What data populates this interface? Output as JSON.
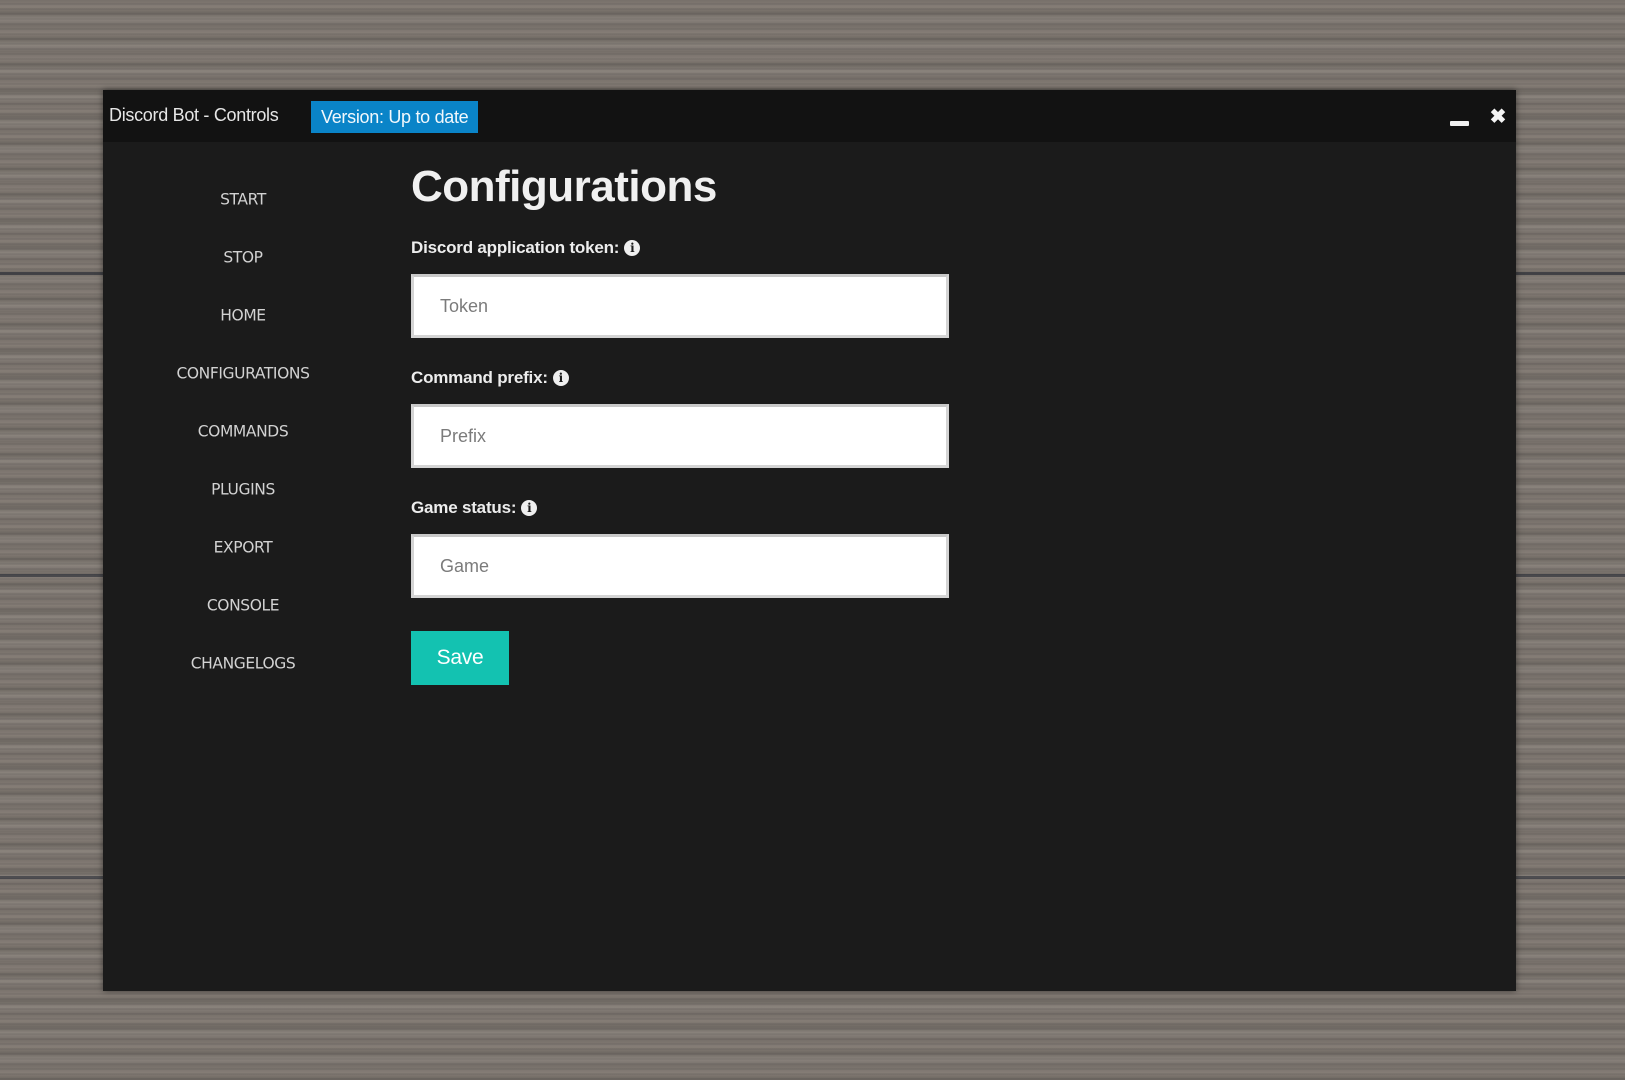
{
  "window": {
    "title": "Discord Bot - Controls",
    "version_badge": "Version: Up to date",
    "minimize_icon": "minimize-icon",
    "close_icon": "close-icon",
    "close_glyph": "✖"
  },
  "sidebar": {
    "items": [
      {
        "label": "START"
      },
      {
        "label": "STOP"
      },
      {
        "label": "HOME"
      },
      {
        "label": "CONFIGURATIONS"
      },
      {
        "label": "COMMANDS"
      },
      {
        "label": "PLUGINS"
      },
      {
        "label": "EXPORT"
      },
      {
        "label": "CONSOLE"
      },
      {
        "label": "CHANGELOGS"
      }
    ]
  },
  "main": {
    "title": "Configurations",
    "info_glyph": "i",
    "fields": [
      {
        "label": "Discord application token:",
        "placeholder": "Token",
        "value": ""
      },
      {
        "label": "Command prefix:",
        "placeholder": "Prefix",
        "value": ""
      },
      {
        "label": "Game status:",
        "placeholder": "Game",
        "value": ""
      }
    ],
    "save_label": "Save"
  },
  "colors": {
    "accent_badge": "#0a84c8",
    "save_button": "#13c2b1",
    "window_bg": "#1b1b1b",
    "titlebar_bg": "#121212"
  }
}
